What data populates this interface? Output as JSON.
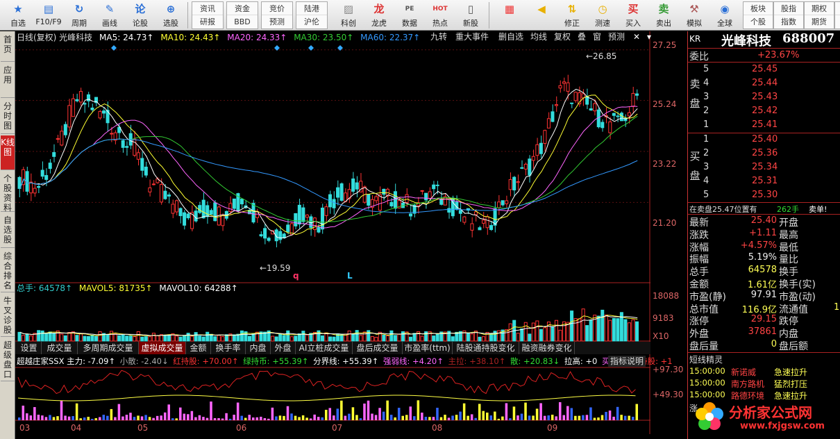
{
  "toolbar": {
    "items": [
      {
        "label": "自选",
        "icon": "star-icon",
        "color": "#2a6fd6"
      },
      {
        "label": "F10/F9",
        "icon": "document-icon",
        "color": "#2a6fd6"
      },
      {
        "label": "周期",
        "icon": "clock-icon",
        "color": "#2a6fd6"
      },
      {
        "label": "画线",
        "icon": "pencil-icon",
        "color": "#2a6fd6"
      },
      {
        "label": "论股",
        "icon": "chat-icon",
        "color": "#2a6fd6"
      },
      {
        "label": "选股",
        "icon": "magnify-chart-icon",
        "color": "#2a6fd6"
      }
    ],
    "grid1": [
      [
        "资讯",
        "研报"
      ],
      [
        "资金",
        "BBD"
      ],
      [
        "竞价",
        "预测"
      ],
      [
        "陆港",
        "沪伦"
      ]
    ],
    "items2": [
      {
        "label": "科创",
        "icon": "chart-icon",
        "color": "#888"
      },
      {
        "label": "龙虎",
        "icon": "dragon-icon",
        "color": "#d33"
      },
      {
        "label": "数据",
        "icon": "pe-icon",
        "color": "#555"
      },
      {
        "label": "热点",
        "icon": "hot-icon",
        "color": "#d33"
      },
      {
        "label": "新股",
        "icon": "phone-icon",
        "color": "#555"
      }
    ],
    "items3": [
      {
        "label": "",
        "icon": "grid-color-icon",
        "color": "#e33"
      },
      {
        "label": "",
        "icon": "arrow-left-icon",
        "color": "#e8b000"
      },
      {
        "label": "修正",
        "icon": "arrow-updown-icon",
        "color": "#e8b000"
      },
      {
        "label": "测速",
        "icon": "timer-icon",
        "color": "#e8b000"
      },
      {
        "label": "买入",
        "icon": "buy-icon",
        "color": "#d33"
      },
      {
        "label": "卖出",
        "icon": "sell-icon",
        "color": "#393"
      },
      {
        "label": "模拟",
        "icon": "hammer-icon",
        "color": "#a55"
      },
      {
        "label": "全球",
        "icon": "globe-icon",
        "color": "#2a6fd6"
      }
    ],
    "grid2": [
      [
        "板块",
        "个股"
      ],
      [
        "股指",
        "指数"
      ],
      [
        "期权",
        "期货"
      ],
      [
        "债券",
        "基金"
      ]
    ]
  },
  "leftnav": [
    {
      "label": "首页",
      "active": false
    },
    {
      "label": "应用",
      "active": false
    },
    {
      "label": "分时图",
      "active": false
    },
    {
      "label": "K线图",
      "active": true
    },
    {
      "label": "个股资料",
      "active": false
    },
    {
      "label": "自选股",
      "active": false
    },
    {
      "label": "综合排名",
      "active": false
    },
    {
      "label": "牛叉诊股",
      "active": false
    },
    {
      "label": "超级盘口",
      "active": false
    }
  ],
  "chart_header": {
    "title": "日线(复权) 光峰科技",
    "ma5": "MA5: 24.73↑",
    "ma10": "MA10: 24.43↑",
    "ma20": "MA20: 24.33↑",
    "ma30": "MA30: 23.50↑",
    "ma60": "MA60: 22.37↑",
    "tags": [
      "九转",
      "重大事件",
      "删自选",
      "均线",
      "复权",
      "叠",
      "窗",
      "预测"
    ]
  },
  "price_axis": [
    "27.25",
    "25.24",
    "23.22",
    "21.20"
  ],
  "volume_axis": [
    "18088",
    "9183",
    "X10"
  ],
  "indicator_axis": [
    "+97.30",
    "+49.30"
  ],
  "annotations": {
    "high": "26.85",
    "low": "19.59",
    "q": "q",
    "L": "L"
  },
  "volume_header": {
    "total": "总手: 64578↑",
    "mavol5": "MAVOL5: 81735↑",
    "mavol10": "MAVOL10: 64288↑"
  },
  "tabs": [
    "设置",
    "成交量",
    "多周期成交量",
    "虚拟成交量",
    "金额",
    "换手率",
    "内盘",
    "外盘",
    "AI立桩成交量",
    "盘后成交量",
    "市盈率(ttm)",
    "陆股通持股变化",
    "融资融券变化"
  ],
  "indicator_header": {
    "name": "超越庄家SSX 主力: -7.09↑",
    "xs": "小散: -2.40↓",
    "hcg": "红持股: +70.00↑",
    "lcb": "绿持币: +55.39↑",
    "fjx": "分界线: +55.39↑",
    "rqx": "强弱线: +4.20↑",
    "zl": "主拉: +38.10↑",
    "san": "散: +20.83↓",
    "lg": "拉高: +0",
    "md": "买点: +0",
    "cg": "持股: +1",
    "help": "指标说明"
  },
  "x_axis": [
    "03",
    "04",
    "05",
    "06",
    "07",
    "08",
    "09"
  ],
  "quote": {
    "code_label": "KR",
    "name": "光峰科技",
    "code": "688007",
    "weibi_label": "委比",
    "weibi": "+23.67%",
    "sell_label": "卖盘",
    "buy_label": "买盘",
    "sell": [
      {
        "lv": "5",
        "p": "25.45"
      },
      {
        "lv": "4",
        "p": "25.44"
      },
      {
        "lv": "3",
        "p": "25.43"
      },
      {
        "lv": "2",
        "p": "25.42"
      },
      {
        "lv": "1",
        "p": "25.41"
      }
    ],
    "buy": [
      {
        "lv": "1",
        "p": "25.40"
      },
      {
        "lv": "2",
        "p": "25.36"
      },
      {
        "lv": "3",
        "p": "25.34"
      },
      {
        "lv": "4",
        "p": "25.31"
      },
      {
        "lv": "5",
        "p": "25.30"
      }
    ],
    "trade_info": "在卖盘25.47位置有",
    "trade_vol": "262手",
    "trade_tag": "卖单!",
    "stats": [
      {
        "k": "最新",
        "v": "25.40",
        "c": "red",
        "k2": "开盘"
      },
      {
        "k": "涨跌",
        "v": "+1.11",
        "c": "red",
        "k2": "最高"
      },
      {
        "k": "涨幅",
        "v": "+4.57%",
        "c": "red",
        "k2": "最低"
      },
      {
        "k": "振幅",
        "v": "5.19%",
        "c": "wht",
        "k2": "量比"
      },
      {
        "k": "总手",
        "v": "64578",
        "c": "yel",
        "k2": "换手"
      },
      {
        "k": "金额",
        "v": "1.61亿",
        "c": "yel",
        "k2": "换手(实)"
      },
      {
        "k": "市盈(静)",
        "v": "97.91",
        "c": "wht",
        "k2": "市盈(动)"
      },
      {
        "k": "总市值",
        "v": "116.9亿",
        "c": "yel",
        "k2": "流通值"
      },
      {
        "k": "涨停",
        "v": "29.15",
        "c": "red",
        "k2": "跌停"
      },
      {
        "k": "外盘",
        "v": "37861",
        "c": "red",
        "k2": "内盘"
      },
      {
        "k": "盘后量",
        "v": "0",
        "c": "yel",
        "k2": "盘后额"
      }
    ],
    "circ_val": "1",
    "news_title": "短线精灵",
    "news": [
      {
        "t": "15:00:00",
        "n": "新诺威",
        "e": "急速拉升"
      },
      {
        "t": "15:00:00",
        "n": "南方路机",
        "e": "猛烈打压"
      },
      {
        "t": "15:00:00",
        "n": "路德环境",
        "e": "急速拉升"
      }
    ],
    "news_more": "涨"
  },
  "logo": {
    "title": "分析家公式网",
    "url": "www.fxjgsw.com"
  },
  "colors": {
    "up": "#ff3333",
    "down": "#33dddd",
    "ma5": "#ffffff",
    "ma10": "#ffff33",
    "ma20": "#ff66ff",
    "ma30": "#33cc33",
    "ma60": "#3399ff"
  }
}
